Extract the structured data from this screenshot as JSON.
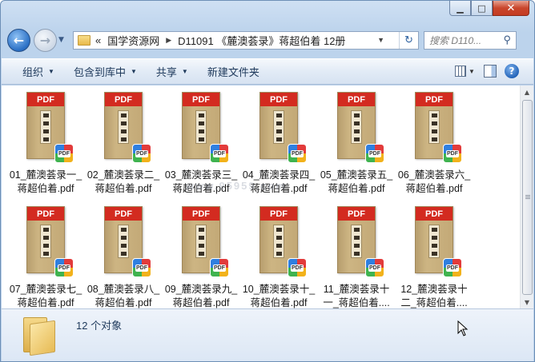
{
  "window": {
    "caption": {
      "minimize": "▁",
      "maximize": "□",
      "close": "✕"
    }
  },
  "nav": {
    "back_glyph": "←",
    "forward_glyph": "→",
    "recent_glyph": "▼",
    "address": {
      "prefix": "«",
      "crumbs": [
        "国学资源网",
        "D11091 《麓澳荟录》蒋超伯着 12册"
      ],
      "separator": "▶",
      "dropdown_glyph": "▼",
      "refresh_glyph": "↻"
    },
    "search": {
      "placeholder": "搜索 D110...",
      "icon": "search-icon"
    }
  },
  "toolbar": {
    "organize": "组织",
    "include_library": "包含到库中",
    "share": "共享",
    "new_folder": "新建文件夹",
    "arrow": "▼"
  },
  "files": [
    {
      "line1": "01_麓澳荟录一_",
      "line2": "蒋超伯着.pdf"
    },
    {
      "line1": "02_麓澳荟录二_",
      "line2": "蒋超伯着.pdf"
    },
    {
      "line1": "03_麓澳荟录三_",
      "line2": "蒋超伯着.pdf"
    },
    {
      "line1": "04_麓澳荟录四_",
      "line2": "蒋超伯着.pdf"
    },
    {
      "line1": "05_麓澳荟录五_",
      "line2": "蒋超伯着.pdf"
    },
    {
      "line1": "06_麓澳荟录六_",
      "line2": "蒋超伯着.pdf"
    },
    {
      "line1": "07_麓澳荟录七_",
      "line2": "蒋超伯着.pdf"
    },
    {
      "line1": "08_麓澳荟录八_",
      "line2": "蒋超伯着.pdf"
    },
    {
      "line1": "09_麓澳荟录九_",
      "line2": "蒋超伯着.pdf"
    },
    {
      "line1": "10_麓澳荟录十_",
      "line2": "蒋超伯着.pdf"
    },
    {
      "line1": "11_麓澳荟录十",
      "line2": "一_蒋超伯着...."
    },
    {
      "line1": "12_麓澳荟录十",
      "line2": "二_蒋超伯着...."
    }
  ],
  "thumb": {
    "band_text": "PDF",
    "badge_text": "PDF"
  },
  "watermark": "www.95959.com",
  "status": {
    "item_count": "12 个对象"
  },
  "scroll": {
    "up": "▲",
    "down": "▼"
  }
}
